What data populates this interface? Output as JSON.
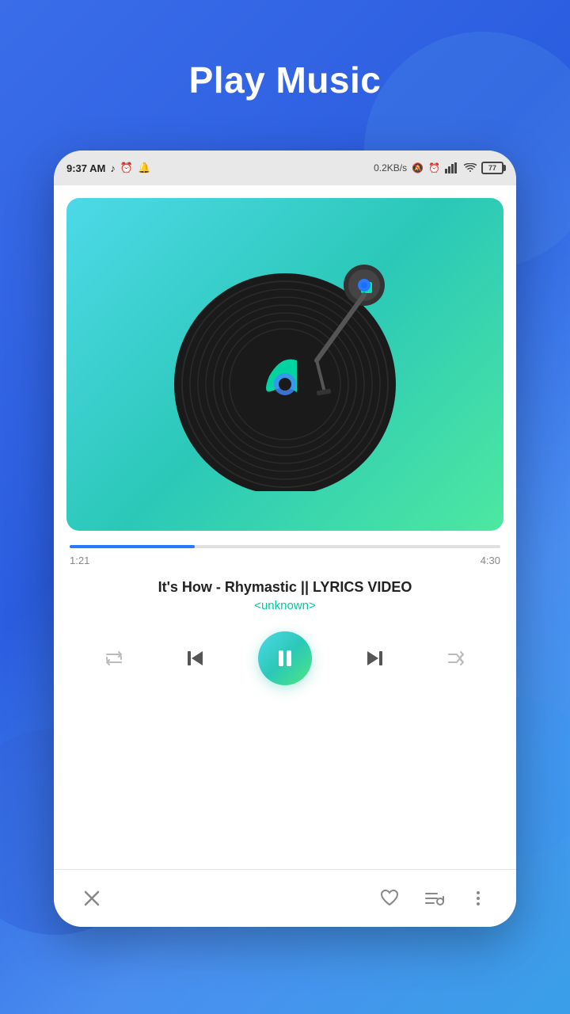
{
  "page": {
    "title": "Play Music",
    "background_gradient": "linear-gradient(135deg, #3a6de8, #4a8ef0)"
  },
  "status_bar": {
    "time": "9:37 AM",
    "network_speed": "0.2KB/s",
    "battery_percent": "77"
  },
  "player": {
    "album_art_bg": "linear-gradient(135deg, #4dd9e8 0%, #2bc8b8 50%, #4de8a0 100%)",
    "progress_current": "1:21",
    "progress_total": "4:30",
    "song_title": "It's How - Rhymastic || LYRICS VIDEO",
    "song_artist": "<unknown>",
    "progress_percent": 29
  },
  "controls": {
    "repeat_label": "repeat",
    "prev_label": "previous",
    "pause_label": "pause",
    "next_label": "next",
    "shuffle_label": "shuffle"
  },
  "bottom_bar": {
    "close_label": "close",
    "favorite_label": "favorite",
    "playlist_label": "playlist",
    "more_label": "more options"
  }
}
